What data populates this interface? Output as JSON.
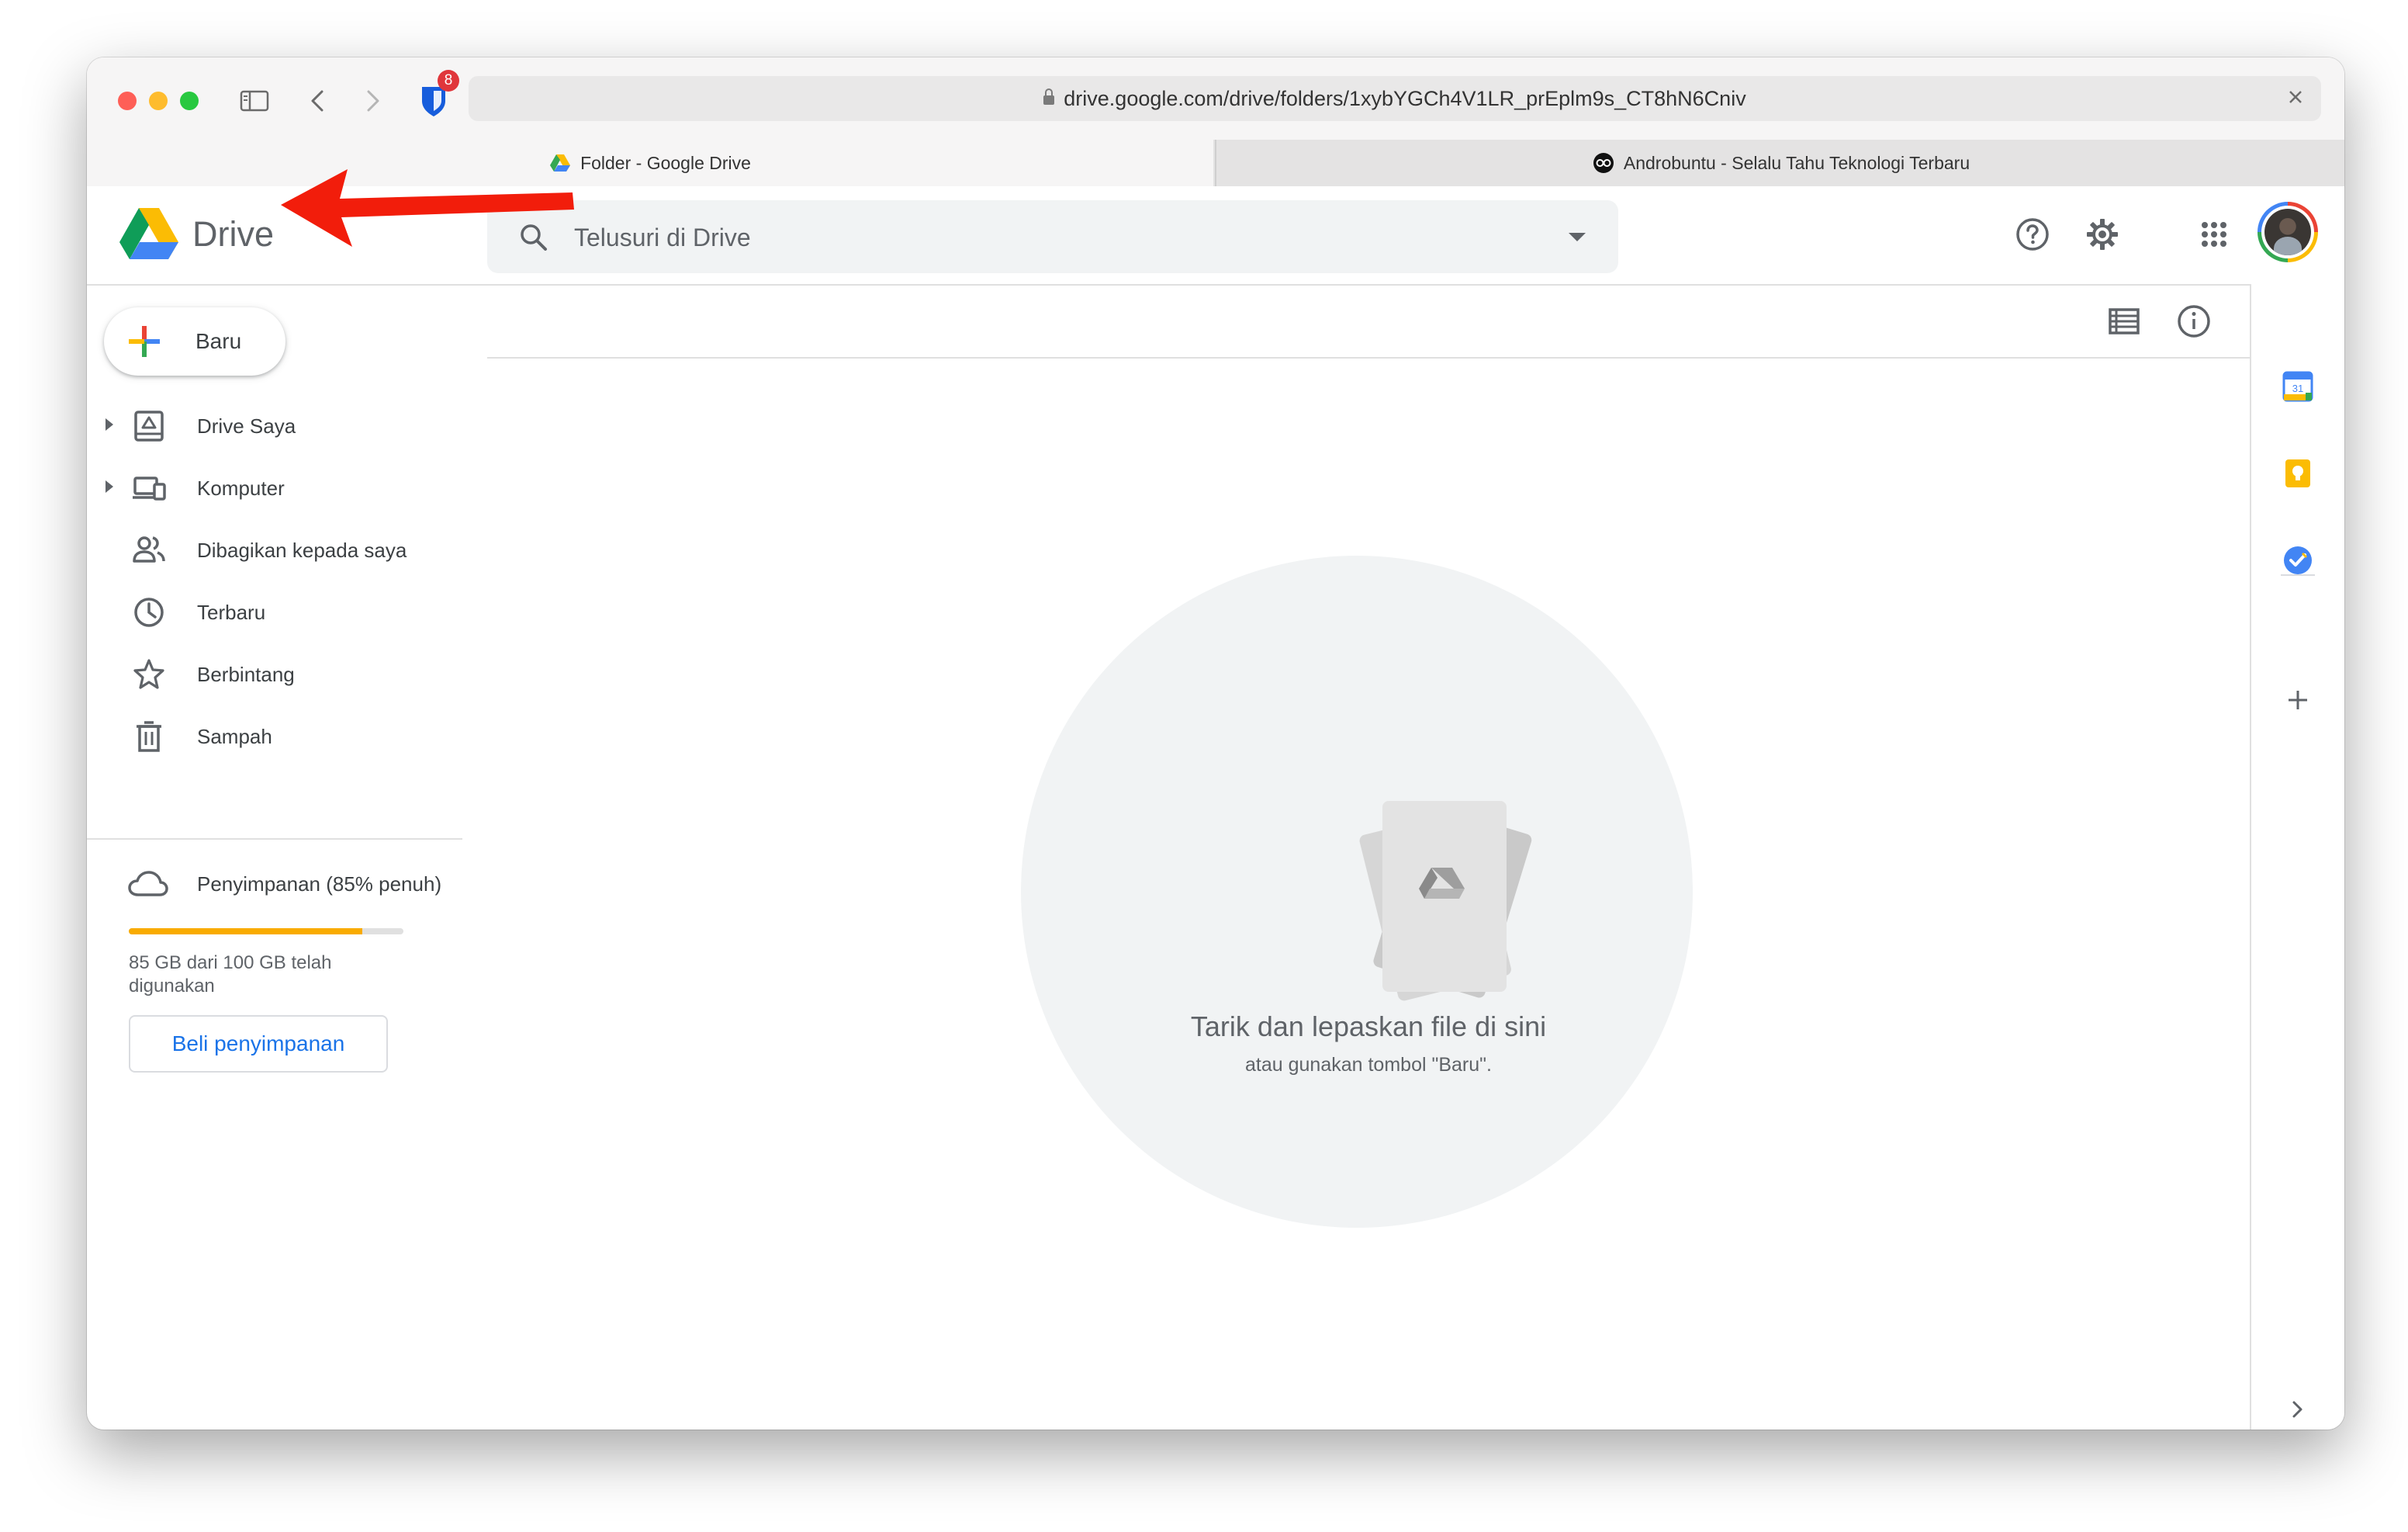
{
  "browser": {
    "url": "drive.google.com/drive/folders/1xybYGCh4V1LR_prEplm9s_CT8hN6Cniv",
    "extension_badge": "8",
    "tabs": [
      {
        "title": "Folder - Google Drive",
        "active": true
      },
      {
        "title": "Androbuntu - Selalu Tahu Teknologi Terbaru",
        "active": false
      }
    ]
  },
  "header": {
    "app_name": "Drive",
    "search_placeholder": "Telusuri di Drive"
  },
  "sidebar": {
    "new_button": "Baru",
    "items": [
      {
        "label": "Drive Saya",
        "icon": "my-drive-icon",
        "expandable": true
      },
      {
        "label": "Komputer",
        "icon": "computers-icon",
        "expandable": true
      },
      {
        "label": "Dibagikan kepada saya",
        "icon": "shared-icon",
        "expandable": false
      },
      {
        "label": "Terbaru",
        "icon": "clock-icon",
        "expandable": false
      },
      {
        "label": "Berbintang",
        "icon": "star-icon",
        "expandable": false
      },
      {
        "label": "Sampah",
        "icon": "trash-icon",
        "expandable": false
      }
    ],
    "storage": {
      "label": "Penyimpanan (85% penuh)",
      "used_fraction": 0.85,
      "detail": "85 GB dari 100 GB telah digunakan",
      "buy_button": "Beli penyimpanan"
    }
  },
  "main": {
    "empty_title": "Tarik dan lepaskan file di sini",
    "empty_subtitle": "atau gunakan tombol \"Baru\"."
  },
  "right_panel": {
    "calendar_day": "31"
  },
  "colors": {
    "blue": "#4285f4",
    "green": "#34a853",
    "yellow": "#fbbc04",
    "red": "#ea4335",
    "arrow": "#f21d0b",
    "storage_fill": "#f9ab00",
    "link_blue": "#1a73e8"
  }
}
